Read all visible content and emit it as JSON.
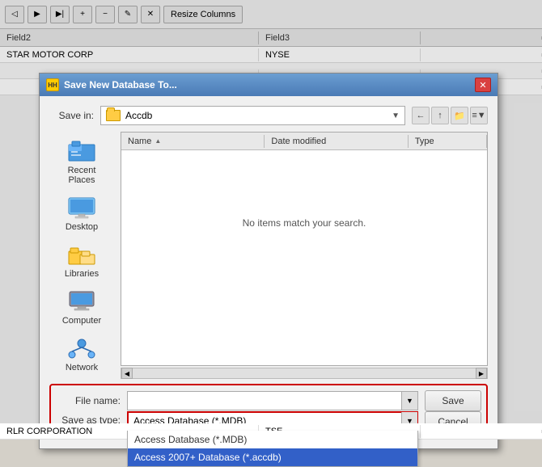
{
  "toolbar": {
    "resize_columns_label": "Resize Columns"
  },
  "spreadsheet": {
    "columns": [
      "Field2",
      "Field3"
    ],
    "rows": [
      {
        "col1": "STAR MOTOR CORP",
        "col2": "NYSE"
      },
      {
        "col1": "",
        "col2": ""
      },
      {
        "col1": "",
        "col2": ""
      },
      {
        "col1": "",
        "col2": ""
      },
      {
        "col1": "RLR CORPORATION",
        "col2": "TSE"
      },
      {
        "col1": "",
        "col2": ""
      }
    ]
  },
  "dialog": {
    "title": "Save New Database To...",
    "icon_label": "HH",
    "save_in_label": "Save in:",
    "save_in_folder": "Accdb",
    "file_list": {
      "columns": {
        "name": "Name",
        "date_modified": "Date modified",
        "type": "Type"
      },
      "empty_message": "No items match your search."
    },
    "file_name_label": "File name:",
    "save_as_type_label": "Save as type:",
    "save_as_type_selected": "Access Database (*.MDB)",
    "save_as_type_options": [
      "Access Database (*.MDB)",
      "Access 2007+ Database (*.accdb)"
    ],
    "save_button": "Save",
    "cancel_button": "Cancel"
  },
  "sidebar": {
    "items": [
      {
        "id": "recent-places",
        "label": "Recent Places"
      },
      {
        "id": "desktop",
        "label": "Desktop"
      },
      {
        "id": "libraries",
        "label": "Libraries"
      },
      {
        "id": "computer",
        "label": "Computer"
      },
      {
        "id": "network",
        "label": "Network"
      }
    ]
  }
}
